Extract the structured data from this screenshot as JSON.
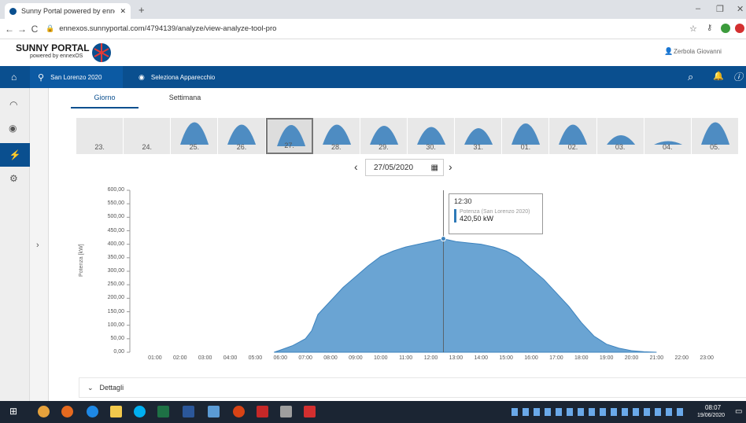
{
  "browser": {
    "tab_title": "Sunny Portal powered by ennexO",
    "url": "ennexos.sunnyportal.com/4794139/analyze/view-analyze-tool-pro"
  },
  "brand": {
    "title": "SUNNY PORTAL",
    "subtitle": "powered by ennexOS",
    "user": "Zerbola Giovanni"
  },
  "topnav": {
    "plant": "San Lorenzo 2020",
    "device": "Seleziona Apparecchio"
  },
  "tabs": {
    "day": "Giorno",
    "week": "Settimana"
  },
  "days": [
    {
      "label": "23.",
      "level": 0
    },
    {
      "label": "24.",
      "level": 0
    },
    {
      "label": "25.",
      "level": 0.95
    },
    {
      "label": "26.",
      "level": 0.85
    },
    {
      "label": "27.",
      "level": 0.9
    },
    {
      "label": "28.",
      "level": 0.85
    },
    {
      "label": "29.",
      "level": 0.8
    },
    {
      "label": "30.",
      "level": 0.75
    },
    {
      "label": "31.",
      "level": 0.7
    },
    {
      "label": "01.",
      "level": 0.9
    },
    {
      "label": "02.",
      "level": 0.85
    },
    {
      "label": "03.",
      "level": 0.4
    },
    {
      "label": "04.",
      "level": 0.15
    },
    {
      "label": "05.",
      "level": 0.95
    }
  ],
  "date_picker": {
    "value": "27/05/2020",
    "prev": "‹",
    "next": "›"
  },
  "tooltip": {
    "time": "12:30",
    "series": "Potenza (San Lorenzo 2020)",
    "value": "420,50 kW"
  },
  "details": {
    "label": "Dettagli"
  },
  "taskbar": {
    "time": "08:07",
    "date": "19/06/2020"
  },
  "chart_data": {
    "type": "area",
    "ylabel": "Potenza [kW]",
    "ylim": [
      0,
      600
    ],
    "yticks": [
      "0,00",
      "50,00",
      "100,00",
      "150,00",
      "200,00",
      "250,00",
      "300,00",
      "350,00",
      "400,00",
      "450,00",
      "500,00",
      "550,00",
      "600,00"
    ],
    "xticks": [
      "01:00",
      "02:00",
      "03:00",
      "04:00",
      "05:00",
      "06:00",
      "07:00",
      "08:00",
      "09:00",
      "10:00",
      "11:00",
      "12:00",
      "13:00",
      "14:00",
      "15:00",
      "16:00",
      "17:00",
      "18:00",
      "19:00",
      "20:00",
      "21:00",
      "22:00",
      "23:00"
    ],
    "series": [
      {
        "name": "Potenza (San Lorenzo 2020)",
        "x": [
          5.75,
          6,
          6.5,
          7,
          7.25,
          7.5,
          8,
          8.5,
          9,
          9.5,
          10,
          10.5,
          11,
          11.5,
          12,
          12.25,
          12.5,
          12.75,
          13,
          13.5,
          14,
          14.5,
          15,
          15.5,
          16,
          16.5,
          17,
          17.5,
          18,
          18.5,
          19,
          19.5,
          20,
          20.5,
          21
        ],
        "y": [
          0,
          8,
          25,
          50,
          80,
          140,
          190,
          240,
          280,
          320,
          355,
          375,
          390,
          400,
          410,
          415,
          420,
          415,
          410,
          405,
          400,
          390,
          375,
          350,
          310,
          270,
          220,
          170,
          110,
          60,
          30,
          15,
          6,
          2,
          0
        ]
      }
    ]
  }
}
